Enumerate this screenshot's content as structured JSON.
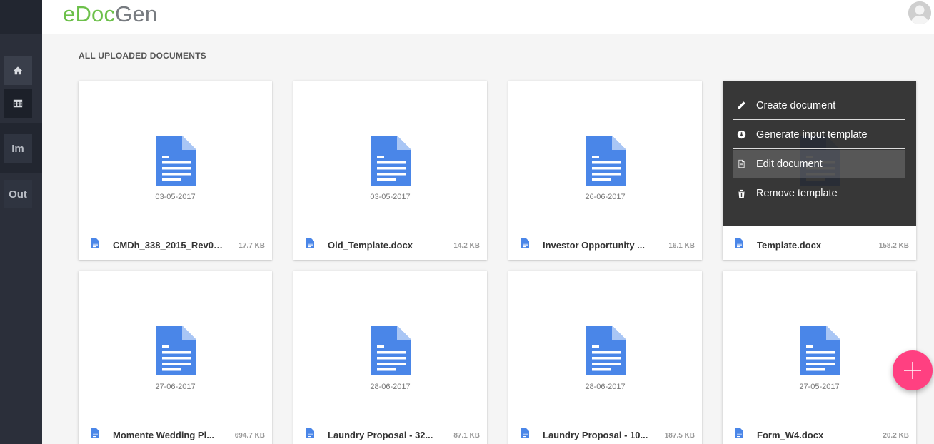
{
  "app": {
    "logo_part1": "eDoc",
    "logo_part2": "Gen"
  },
  "sidebar": {
    "items": [
      {
        "label": "",
        "icon": "home-icon"
      },
      {
        "label": "",
        "icon": "table-icon"
      },
      {
        "label": "Im"
      },
      {
        "label": "Out"
      }
    ]
  },
  "section": {
    "title": "ALL UPLOADED DOCUMENTS"
  },
  "documents": [
    {
      "name": "CMDh_338_2015_Rev0_...",
      "size": "17.7 KB",
      "date": "03-05-2017"
    },
    {
      "name": "Old_Template.docx",
      "size": "14.2 KB",
      "date": "03-05-2017"
    },
    {
      "name": "Investor Opportunity ...",
      "size": "16.1 KB",
      "date": "26-06-2017"
    },
    {
      "name": "Template.docx",
      "size": "158.2 KB",
      "date": ""
    },
    {
      "name": "Momente Wedding Pl...",
      "size": "694.7 KB",
      "date": "27-06-2017"
    },
    {
      "name": "Laundry Proposal - 32...",
      "size": "87.1 KB",
      "date": "28-06-2017"
    },
    {
      "name": "Laundry Proposal - 10...",
      "size": "187.5 KB",
      "date": "28-06-2017"
    },
    {
      "name": "Form_W4.docx",
      "size": "20.2 KB",
      "date": "27-05-2017"
    }
  ],
  "context_menu": {
    "items": [
      {
        "label": "Create document",
        "icon": "pencil-icon"
      },
      {
        "label": "Generate input template",
        "icon": "download-circle-icon"
      },
      {
        "label": "Edit document",
        "icon": "document-icon"
      },
      {
        "label": "Remove template",
        "icon": "trash-icon"
      }
    ]
  },
  "colors": {
    "logo_green": "#6cc04a",
    "logo_gray": "#777b80",
    "doc_blue": "#4a86e8",
    "fab_pink": "#ff4081",
    "sidebar_bg": "#2b2f3a"
  }
}
